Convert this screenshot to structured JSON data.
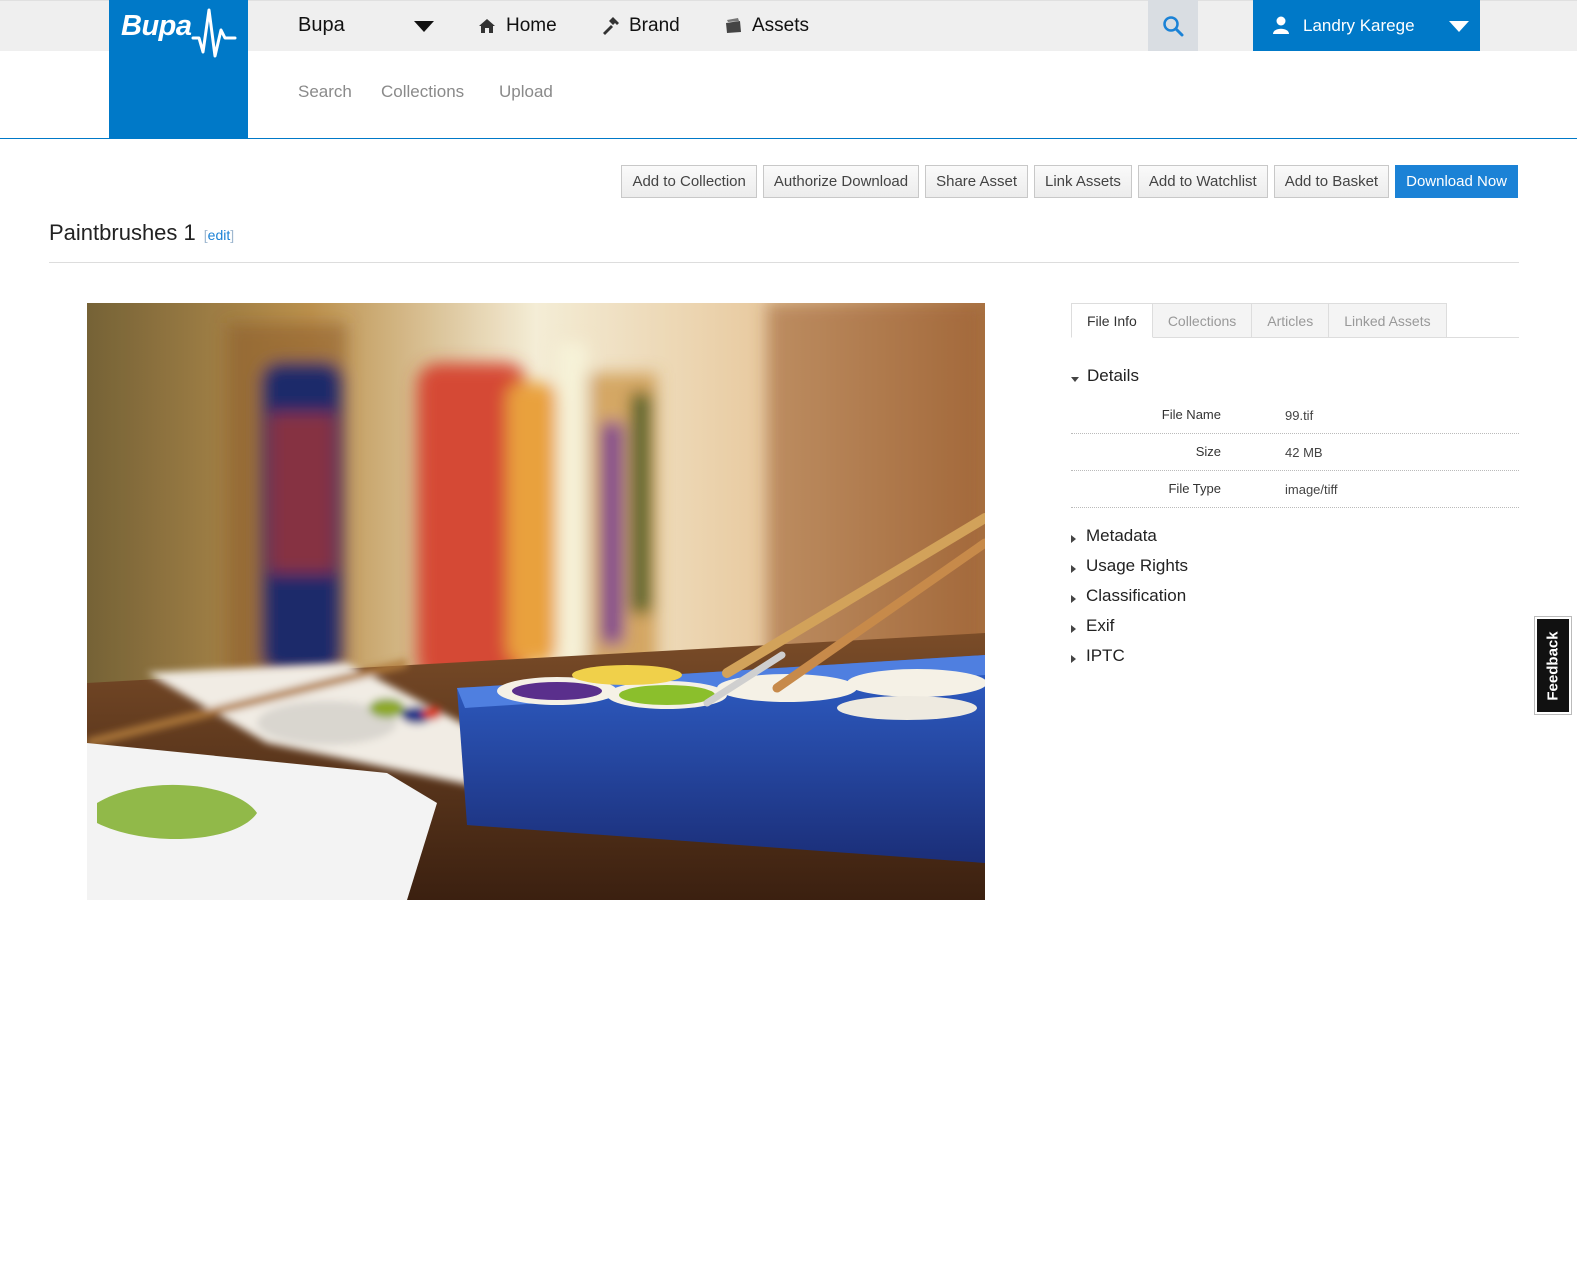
{
  "header": {
    "logo_text": "Bupa",
    "brand_dropdown": "Bupa",
    "nav": [
      {
        "label": "Home",
        "icon": "home-icon"
      },
      {
        "label": "Brand",
        "icon": "hammer-icon"
      },
      {
        "label": "Assets",
        "icon": "box-icon"
      }
    ],
    "search_icon": "search-icon",
    "user_name": "Landry Karege",
    "user_icon": "user-icon"
  },
  "subnav": [
    "Search",
    "Collections",
    "Upload"
  ],
  "actions": [
    "Add to Collection",
    "Authorize Download",
    "Share Asset",
    "Link Assets",
    "Add to Watchlist",
    "Add to Basket",
    "Download Now"
  ],
  "asset": {
    "title": "Paintbrushes 1",
    "edit_label": "edit"
  },
  "panel": {
    "tabs": [
      "File Info",
      "Collections",
      "Articles",
      "Linked Assets"
    ],
    "active_tab": "File Info",
    "details_heading": "Details",
    "details": [
      {
        "key": "File Name",
        "value": "99.tif"
      },
      {
        "key": "Size",
        "value": "42 MB"
      },
      {
        "key": "File Type",
        "value": "image/tiff"
      }
    ],
    "collapsed_sections": [
      "Metadata",
      "Usage Rights",
      "Classification",
      "Exif",
      "IPTC"
    ]
  },
  "feedback_label": "Feedback",
  "colors": {
    "brand_blue": "#0079c8",
    "primary_button": "#1b82d6"
  }
}
